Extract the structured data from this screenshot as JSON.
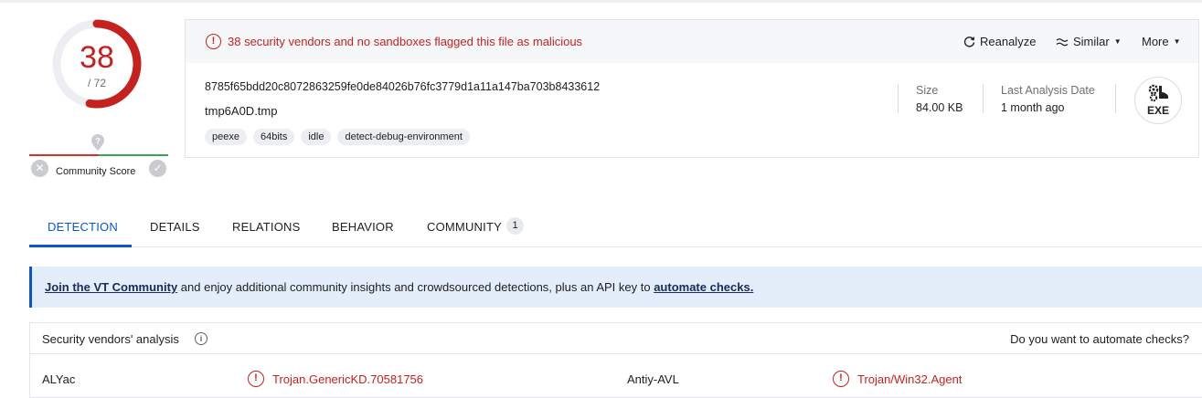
{
  "score": {
    "detections": "38",
    "total": "/ 72",
    "community_label": "Community Score"
  },
  "alert": {
    "text": "38 security vendors and no sandboxes flagged this file as malicious"
  },
  "actions": {
    "reanalyze": "Reanalyze",
    "similar": "Similar",
    "more": "More"
  },
  "file": {
    "hash": "8785f65bdd20c8072863259fe0de84026b76fc3779d1a11a147ba703b8433612",
    "name": "tmp6A0D.tmp",
    "tags": [
      "peexe",
      "64bits",
      "idle",
      "detect-debug-environment"
    ],
    "size_label": "Size",
    "size_value": "84.00 KB",
    "last_analysis_label": "Last Analysis Date",
    "last_analysis_value": "1 month ago",
    "type": "EXE"
  },
  "tabs": [
    {
      "label": "DETECTION"
    },
    {
      "label": "DETAILS"
    },
    {
      "label": "RELATIONS"
    },
    {
      "label": "BEHAVIOR"
    },
    {
      "label": "COMMUNITY",
      "badge": "1"
    }
  ],
  "banner": {
    "link1": "Join the VT Community",
    "middle": " and enjoy additional community insights and crowdsourced detections, plus an API key to ",
    "link2": "automate checks."
  },
  "vendors": {
    "title": "Security vendors' analysis",
    "right_text": "Do you want to automate checks?",
    "rows": [
      {
        "left_vendor": "ALYac",
        "left_result": "Trojan.GenericKD.70581756",
        "right_vendor": "Antiy-AVL",
        "right_result": "Trojan/Win32.Agent"
      }
    ]
  },
  "colors": {
    "malicious": "#c5221f",
    "accent": "#0b57d0",
    "banner_bg": "#e3eefa"
  },
  "icons": [
    "alert-circle-icon",
    "reanalyze-icon",
    "similar-icon",
    "chevron-down-icon",
    "community-marker-icon",
    "gears-icon",
    "info-icon"
  ]
}
